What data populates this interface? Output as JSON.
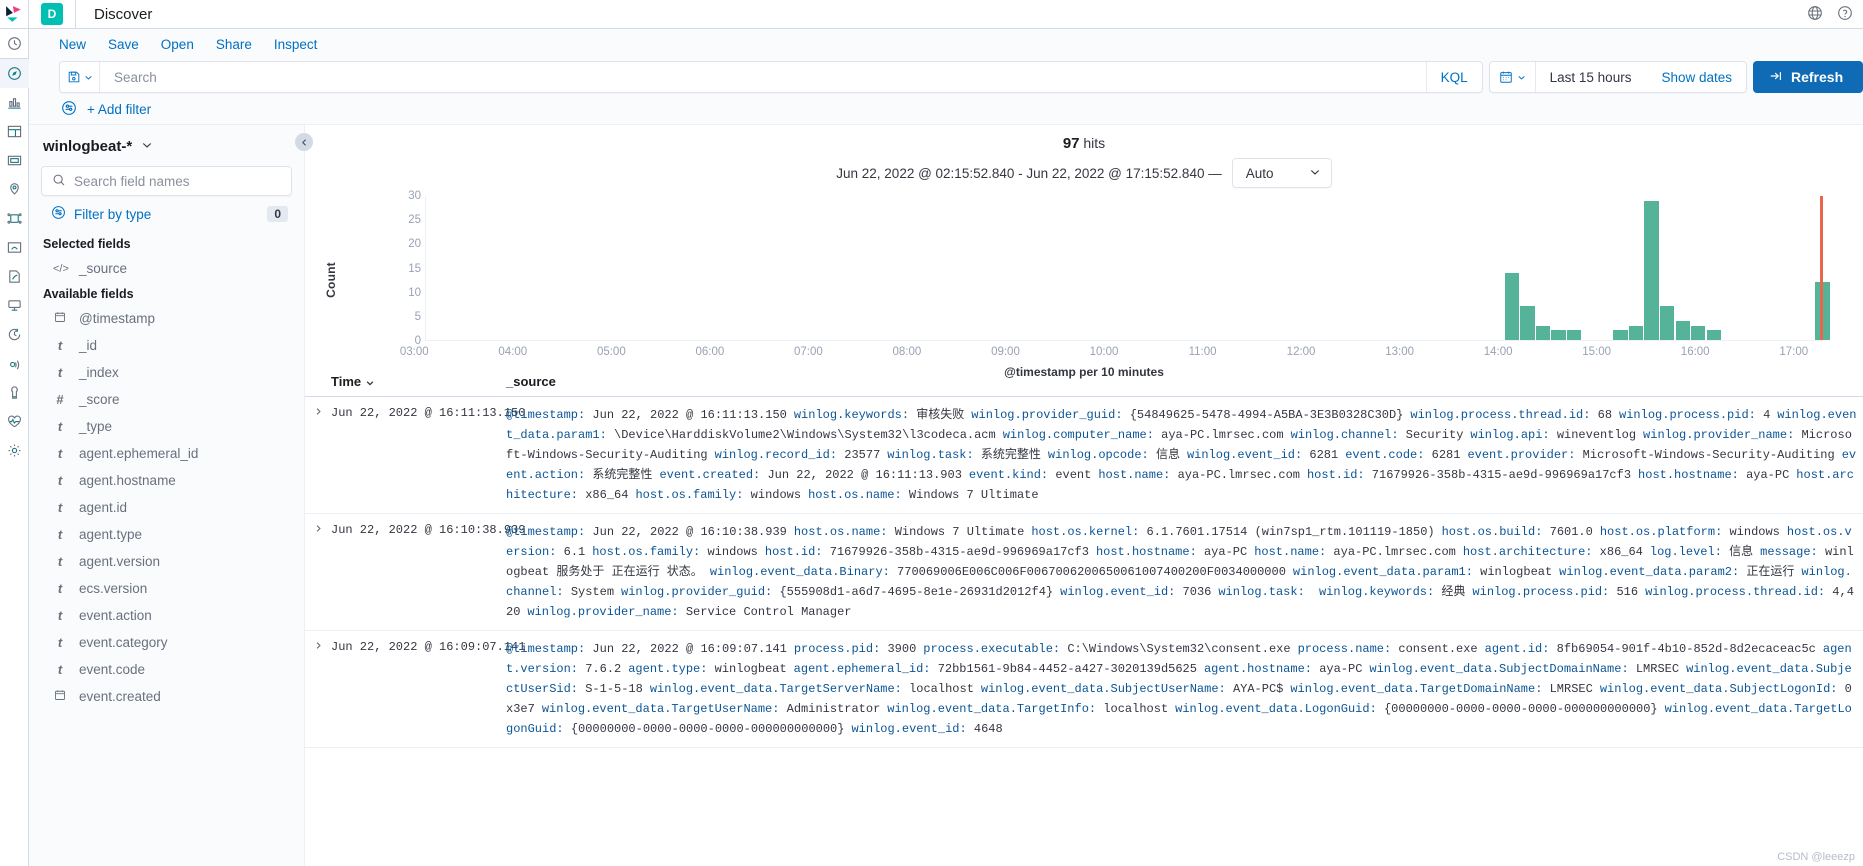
{
  "header": {
    "badge": "D",
    "title": "Discover",
    "right_icons": [
      "globe-icon",
      "help-icon"
    ]
  },
  "actions": [
    {
      "label": "New",
      "name": "new"
    },
    {
      "label": "Save",
      "name": "save"
    },
    {
      "label": "Open",
      "name": "open"
    },
    {
      "label": "Share",
      "name": "share"
    },
    {
      "label": "Inspect",
      "name": "inspect"
    }
  ],
  "query_bar": {
    "search_placeholder": "Search",
    "language": "KQL",
    "date_range": "Last 15 hours",
    "show_dates": "Show dates",
    "refresh": "Refresh",
    "save_query_icon": "save-icon",
    "calendar_icon": "calendar-icon"
  },
  "filter_bar": {
    "add_filter": "+ Add filter",
    "filter_icon": "filter-icon"
  },
  "sidebar": {
    "index_pattern": "winlogbeat-*",
    "field_search_placeholder": "Search field names",
    "filter_by_type": "Filter by type",
    "filter_by_type_count": "0",
    "selected_fields_title": "Selected fields",
    "selected_fields": [
      {
        "name": "_source",
        "type": "source"
      }
    ],
    "available_fields_title": "Available fields",
    "available_fields": [
      {
        "name": "@timestamp",
        "type": "date"
      },
      {
        "name": "_id",
        "type": "string"
      },
      {
        "name": "_index",
        "type": "string"
      },
      {
        "name": "_score",
        "type": "number"
      },
      {
        "name": "_type",
        "type": "string"
      },
      {
        "name": "agent.ephemeral_id",
        "type": "string"
      },
      {
        "name": "agent.hostname",
        "type": "string"
      },
      {
        "name": "agent.id",
        "type": "string"
      },
      {
        "name": "agent.type",
        "type": "string"
      },
      {
        "name": "agent.version",
        "type": "string"
      },
      {
        "name": "ecs.version",
        "type": "string"
      },
      {
        "name": "event.action",
        "type": "string"
      },
      {
        "name": "event.category",
        "type": "string"
      },
      {
        "name": "event.code",
        "type": "string"
      },
      {
        "name": "event.created",
        "type": "date"
      }
    ]
  },
  "rail": {
    "items": [
      {
        "name": "recently-viewed",
        "icon": "clock-icon"
      },
      {
        "name": "discover",
        "icon": "compass-icon",
        "active": true
      },
      {
        "name": "visualize",
        "icon": "bar-chart-icon"
      },
      {
        "name": "dashboard",
        "icon": "dashboard-icon"
      },
      {
        "name": "canvas",
        "icon": "canvas-icon"
      },
      {
        "name": "maps",
        "icon": "map-pin-icon"
      },
      {
        "name": "machine-learning",
        "icon": "ml-icon"
      },
      {
        "name": "infrastructure",
        "icon": "infra-icon"
      },
      {
        "name": "logs",
        "icon": "logs-icon"
      },
      {
        "name": "apm",
        "icon": "apm-icon"
      },
      {
        "name": "uptime",
        "icon": "uptime-icon"
      },
      {
        "name": "siem",
        "icon": "siem-icon"
      },
      {
        "name": "dev-tools",
        "icon": "wrench-icon"
      },
      {
        "name": "monitoring",
        "icon": "heart-icon"
      },
      {
        "name": "management",
        "icon": "gear-icon"
      }
    ]
  },
  "results": {
    "hits_count": "97",
    "hits_label": "hits",
    "time_range_text": "Jun 22, 2022 @ 02:15:52.840 - Jun 22, 2022 @ 17:15:52.840 —",
    "interval": "Auto"
  },
  "chart_data": {
    "type": "bar",
    "title": "",
    "xlabel": "@timestamp per 10 minutes",
    "ylabel": "Count",
    "ylim": [
      0,
      30
    ],
    "yticks": [
      0,
      5,
      10,
      15,
      20,
      25,
      30
    ],
    "xticks": [
      "03:00",
      "04:00",
      "05:00",
      "06:00",
      "07:00",
      "08:00",
      "09:00",
      "10:00",
      "11:00",
      "12:00",
      "13:00",
      "14:00",
      "15:00",
      "16:00",
      "17:00"
    ],
    "grid": false,
    "bar_color": "#54b399",
    "partial_bucket_color": "#e7664c",
    "x": [
      "13:50",
      "14:00",
      "14:10",
      "14:20",
      "14:30",
      "15:00",
      "15:10",
      "15:20",
      "15:30",
      "15:40",
      "15:50",
      "16:00",
      "17:10"
    ],
    "values": [
      14,
      7,
      3,
      2,
      2,
      2,
      3,
      29,
      7,
      4,
      3,
      2,
      12
    ],
    "categories": [
      "13:50",
      "14:00",
      "14:10",
      "14:20",
      "14:30",
      "15:00",
      "15:10",
      "15:20",
      "15:30",
      "15:40",
      "15:50",
      "16:00",
      "17:10"
    ]
  },
  "doc_table": {
    "columns": {
      "time": "Time",
      "source": "_source",
      "sort_icon": "sort-desc-icon"
    },
    "rows": [
      {
        "time": "Jun 22, 2022 @ 16:11:13.150",
        "fields": [
          {
            "k": "@timestamp:",
            "v": "Jun 22, 2022 @ 16:11:13.150"
          },
          {
            "k": "winlog.keywords:",
            "v": "审核失败"
          },
          {
            "k": "winlog.provider_guid:",
            "v": "{54849625-5478-4994-A5BA-3E3B0328C30D}"
          },
          {
            "k": "winlog.process.thread.id:",
            "v": "68"
          },
          {
            "k": "winlog.process.pid:",
            "v": "4"
          },
          {
            "k": "winlog.event_data.param1:",
            "v": "\\Device\\HarddiskVolume2\\Windows\\System32\\l3codeca.acm"
          },
          {
            "k": "winlog.computer_name:",
            "v": "aya-PC.lmrsec.com"
          },
          {
            "k": "winlog.channel:",
            "v": "Security"
          },
          {
            "k": "winlog.api:",
            "v": "wineventlog"
          },
          {
            "k": "winlog.provider_name:",
            "v": "Microsoft-Windows-Security-Auditing"
          },
          {
            "k": "winlog.record_id:",
            "v": "23577"
          },
          {
            "k": "winlog.task:",
            "v": "系统完整性"
          },
          {
            "k": "winlog.opcode:",
            "v": "信息"
          },
          {
            "k": "winlog.event_id:",
            "v": "6281"
          },
          {
            "k": "event.code:",
            "v": "6281"
          },
          {
            "k": "event.provider:",
            "v": "Microsoft-Windows-Security-Auditing"
          },
          {
            "k": "event.action:",
            "v": "系统完整性"
          },
          {
            "k": "event.created:",
            "v": "Jun 22, 2022 @ 16:11:13.903"
          },
          {
            "k": "event.kind:",
            "v": "event"
          },
          {
            "k": "host.name:",
            "v": "aya-PC.lmrsec.com"
          },
          {
            "k": "host.id:",
            "v": "71679926-358b-4315-ae9d-996969a17cf3"
          },
          {
            "k": "host.hostname:",
            "v": "aya-PC"
          },
          {
            "k": "host.architecture:",
            "v": "x86_64"
          },
          {
            "k": "host.os.family:",
            "v": "windows"
          },
          {
            "k": "host.os.name:",
            "v": "Windows 7 Ultimate"
          }
        ]
      },
      {
        "time": "Jun 22, 2022 @ 16:10:38.939",
        "fields": [
          {
            "k": "@timestamp:",
            "v": "Jun 22, 2022 @ 16:10:38.939"
          },
          {
            "k": "host.os.name:",
            "v": "Windows 7 Ultimate"
          },
          {
            "k": "host.os.kernel:",
            "v": "6.1.7601.17514 (win7sp1_rtm.101119-1850)"
          },
          {
            "k": "host.os.build:",
            "v": "7601.0"
          },
          {
            "k": "host.os.platform:",
            "v": "windows"
          },
          {
            "k": "host.os.version:",
            "v": "6.1"
          },
          {
            "k": "host.os.family:",
            "v": "windows"
          },
          {
            "k": "host.id:",
            "v": "71679926-358b-4315-ae9d-996969a17cf3"
          },
          {
            "k": "host.hostname:",
            "v": "aya-PC"
          },
          {
            "k": "host.name:",
            "v": "aya-PC.lmrsec.com"
          },
          {
            "k": "host.architecture:",
            "v": "x86_64"
          },
          {
            "k": "log.level:",
            "v": "信息"
          },
          {
            "k": "message:",
            "v": "winlogbeat 服务处于 正在运行 状态。"
          },
          {
            "k": "winlog.event_data.Binary:",
            "v": "770069006E006C006F0067006200650061007400200F0034000000"
          },
          {
            "k": "winlog.event_data.param1:",
            "v": "winlogbeat"
          },
          {
            "k": "winlog.event_data.param2:",
            "v": "正在运行"
          },
          {
            "k": "winlog.channel:",
            "v": "System"
          },
          {
            "k": "winlog.provider_guid:",
            "v": "{555908d1-a6d7-4695-8e1e-26931d2012f4}"
          },
          {
            "k": "winlog.event_id:",
            "v": "7036"
          },
          {
            "k": "winlog.task:",
            "v": ""
          },
          {
            "k": "winlog.keywords:",
            "v": "经典"
          },
          {
            "k": "winlog.process.pid:",
            "v": "516"
          },
          {
            "k": "winlog.process.thread.id:",
            "v": "4,420"
          },
          {
            "k": "winlog.provider_name:",
            "v": "Service Control Manager"
          }
        ]
      },
      {
        "time": "Jun 22, 2022 @ 16:09:07.141",
        "fields": [
          {
            "k": "@timestamp:",
            "v": "Jun 22, 2022 @ 16:09:07.141"
          },
          {
            "k": "process.pid:",
            "v": "3900"
          },
          {
            "k": "process.executable:",
            "v": "C:\\Windows\\System32\\consent.exe"
          },
          {
            "k": "process.name:",
            "v": "consent.exe"
          },
          {
            "k": "agent.id:",
            "v": "8fb69054-901f-4b10-852d-8d2ecaceac5c"
          },
          {
            "k": "agent.version:",
            "v": "7.6.2"
          },
          {
            "k": "agent.type:",
            "v": "winlogbeat"
          },
          {
            "k": "agent.ephemeral_id:",
            "v": "72bb1561-9b84-4452-a427-3020139d5625"
          },
          {
            "k": "agent.hostname:",
            "v": "aya-PC"
          },
          {
            "k": "winlog.event_data.SubjectDomainName:",
            "v": "LMRSEC"
          },
          {
            "k": "winlog.event_data.SubjectUserSid:",
            "v": "S-1-5-18"
          },
          {
            "k": "winlog.event_data.TargetServerName:",
            "v": "localhost"
          },
          {
            "k": "winlog.event_data.SubjectUserName:",
            "v": "AYA-PC$"
          },
          {
            "k": "winlog.event_data.TargetDomainName:",
            "v": "LMRSEC"
          },
          {
            "k": "winlog.event_data.SubjectLogonId:",
            "v": "0x3e7"
          },
          {
            "k": "winlog.event_data.TargetUserName:",
            "v": "Administrator"
          },
          {
            "k": "winlog.event_data.TargetInfo:",
            "v": "localhost"
          },
          {
            "k": "winlog.event_data.LogonGuid:",
            "v": "{00000000-0000-0000-0000-000000000000}"
          },
          {
            "k": "winlog.event_data.TargetLogonGuid:",
            "v": "{00000000-0000-0000-0000-000000000000}"
          },
          {
            "k": "winlog.event_id:",
            "v": "4648"
          }
        ]
      }
    ]
  },
  "watermark": "CSDN @leeezp"
}
